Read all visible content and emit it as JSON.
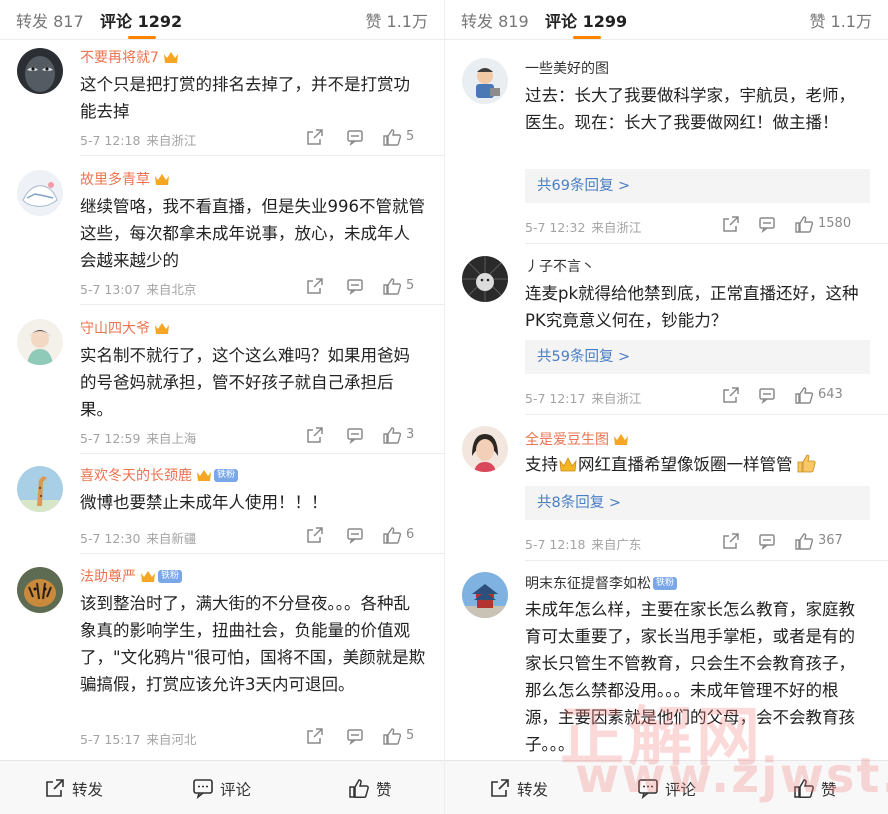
{
  "left": {
    "tabs": {
      "repost": "转发 817",
      "comment": "评论 1292",
      "like": "赞 1.1万"
    },
    "comments": [
      {
        "user": "不要再将就7",
        "text": "这个只是把打赏的排名去掉了，并不是打赏功能去掉",
        "time": "5-7 12:18",
        "source": "来自浙江",
        "likes": "5"
      },
      {
        "user": "故里多青草",
        "text": "继续管咯，我不看直播，但是失业996不管就管这些，每次都拿未成年说事，放心，未成年人会越来越少的",
        "time": "5-7 13:07",
        "source": "来自北京",
        "likes": "5"
      },
      {
        "user": "守山四大爷",
        "text": "实名制不就行了，这个这么难吗？如果用爸妈的号爸妈就承担，管不好孩子就自己承担后果。",
        "time": "5-7 12:59",
        "source": "来自上海",
        "likes": "3"
      },
      {
        "user": "喜欢冬天的长颈鹿",
        "fan": "铁粉",
        "text": "微博也要禁止未成年人使用！！！",
        "time": "5-7 12:30",
        "source": "来自新疆",
        "likes": "6"
      },
      {
        "user": "法助尊严",
        "fan": "铁粉",
        "text": "该到整治时了，满大街的不分昼夜。。。各种乱象真的影响学生，扭曲社会，负能量的价值观了，\"文化鸦片\"很可怕，国将不国，美颜就是欺骗搞假，打赏应该允许3天内可退回。",
        "time": "5-7 15:17",
        "source": "来自河北",
        "likes": "5"
      }
    ],
    "bottom": {
      "repost": "转发",
      "comment": "评论",
      "like": "赞"
    }
  },
  "right": {
    "tabs": {
      "repost": "转发 819",
      "comment": "评论 1299",
      "like": "赞 1.1万"
    },
    "comments": [
      {
        "user": "一些美好的图",
        "text": "过去：长大了我要做科学家，宇航员，老师，医生。现在：长大了我要做网红！做主播！",
        "replies": "共69条回复 >",
        "time": "5-7 12:32",
        "source": "来自浙江",
        "likes": "1580"
      },
      {
        "user": "丿子不言丶",
        "text": "连麦pk就得给他禁到底，正常直播还好，这种PK究竟意义何在，钞能力？",
        "replies": "共59条回复 >",
        "time": "5-7 12:17",
        "source": "来自浙江",
        "likes": "643"
      },
      {
        "user": "全是爱豆生图",
        "text_a": "支持",
        "text_b": "网红直播希望像饭圈一样管管",
        "replies": "共8条回复 >",
        "time": "5-7 12:18",
        "source": "来自广东",
        "likes": "367"
      },
      {
        "user": "明末东征提督李如松",
        "fan": "铁粉",
        "text": "未成年怎么样，主要在家长怎么教育，家庭教育可太重要了，家长当甩手掌柜，或者是有的家长只管生不管教育，只会生不会教育孩子，那么怎么禁都没用。。。未成年管理不好的根源，主要因素就是他们的父母，会不会教育孩子。。。"
      }
    ],
    "bottom": {
      "repost": "转发",
      "comment": "评论",
      "like": "赞"
    }
  },
  "watermark": {
    "line1": "正解网",
    "line2": "www.zjwst.com"
  },
  "colors": {
    "accent": "#ff8200",
    "username": "#eb7350",
    "link": "#4a7ec4"
  }
}
